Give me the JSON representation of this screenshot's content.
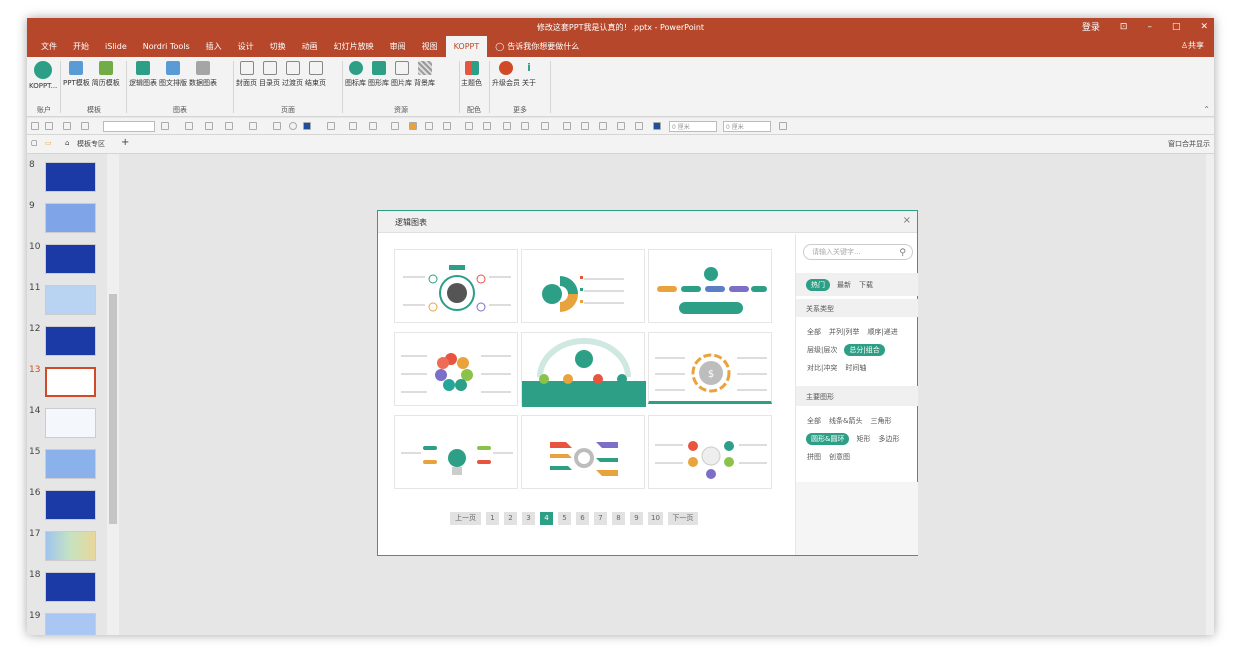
{
  "window": {
    "title": "修改这套PPT我是认真的！.pptx - PowerPoint",
    "signin": "登录",
    "ribbon_display": "⊡",
    "minimize": "–",
    "maximize": "□",
    "close": "✕"
  },
  "tabs": [
    "文件",
    "开始",
    "iSlide",
    "Nordri Tools",
    "插入",
    "设计",
    "切换",
    "动画",
    "幻灯片放映",
    "审阅",
    "视图",
    "KOPPT"
  ],
  "tell_me": "告诉我你想要做什么",
  "share": "共享",
  "ribbon_groups": [
    {
      "label": "账户",
      "buttons": [
        "KOPPT..."
      ]
    },
    {
      "label": "模板",
      "buttons": [
        "PPT模板",
        "简历模板"
      ]
    },
    {
      "label": "图表",
      "buttons": [
        "逻辑图表",
        "图文排版",
        "数据图表"
      ]
    },
    {
      "label": "页面",
      "buttons": [
        "封面页",
        "目录页",
        "过渡页",
        "结束页"
      ]
    },
    {
      "label": "资源",
      "buttons": [
        "图标库",
        "图形库",
        "图片库",
        "背景库"
      ]
    },
    {
      "label": "配色",
      "buttons": [
        "主题色"
      ]
    },
    {
      "label": "更多",
      "buttons": [
        "升级会员",
        "关于"
      ]
    }
  ],
  "format_fields": {
    "width": "0 厘米",
    "height": "0 厘米"
  },
  "tabbar": {
    "template_zone": "模板专区",
    "add": "+",
    "merge": "窗口合并显示"
  },
  "slide_numbers": [
    "8",
    "9",
    "10",
    "11",
    "12",
    "13",
    "14",
    "15",
    "16",
    "17",
    "18",
    "19"
  ],
  "selected_slide": "13",
  "dialog": {
    "title": "逻辑图表",
    "close": "×",
    "search_placeholder": "请输入关键字...",
    "filters": [
      "热门",
      "最新",
      "下载"
    ],
    "relation_title": "关系类型",
    "relation_chips": [
      "全部",
      "并列|列举",
      "顺序|递进",
      "层级|层次",
      "总分|组合",
      "对比|冲突",
      "时间轴"
    ],
    "shape_title": "主要图形",
    "shape_chips": [
      "全部",
      "线条&箭头",
      "三角形",
      "圆形&圆环",
      "矩形",
      "多边形",
      "拼图",
      "创意图"
    ],
    "pager": [
      "上一页",
      "1",
      "2",
      "3",
      "4",
      "5",
      "6",
      "7",
      "8",
      "9",
      "10",
      "下一页"
    ],
    "current_page": "4"
  },
  "colors": {
    "accent": "#2c9f86",
    "ribbon": "#b7472a",
    "selection": "#d04a27"
  }
}
